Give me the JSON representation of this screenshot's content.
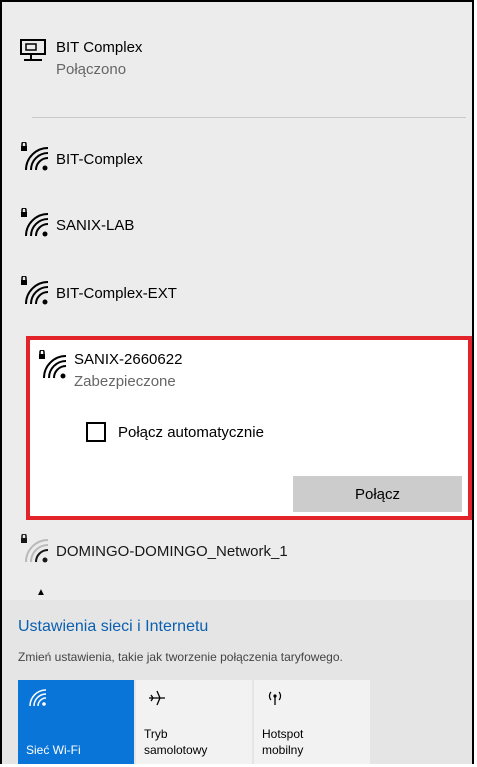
{
  "connected": {
    "name": "BIT Complex",
    "status": "Połączono"
  },
  "networks": [
    {
      "name": "BIT-Complex"
    },
    {
      "name": "SANIX-LAB"
    },
    {
      "name": "BIT-Complex-EXT"
    }
  ],
  "selected": {
    "name": "SANIX-2660622",
    "status": "Zabezpieczone",
    "auto_connect_label": "Połącz automatycznie",
    "connect_label": "Połącz"
  },
  "more_networks": [
    {
      "name": "DOMINGO-DOMINGO_Network_1"
    }
  ],
  "settings": {
    "link": "Ustawienia sieci i Internetu",
    "description": "Zmień ustawienia, takie jak tworzenie połączenia taryfowego."
  },
  "quick_actions": [
    {
      "label": "Sieć Wi-Fi",
      "icon": "wifi-icon",
      "active": true
    },
    {
      "label_line1": "Tryb",
      "label_line2": "samolotowy",
      "icon": "airplane-icon",
      "active": false
    },
    {
      "label_line1": "Hotspot",
      "label_line2": "mobilny",
      "icon": "hotspot-icon",
      "active": false
    }
  ],
  "colors": {
    "highlight": "#e2232a",
    "accent": "#0a75d8",
    "link": "#0a5fb0"
  }
}
